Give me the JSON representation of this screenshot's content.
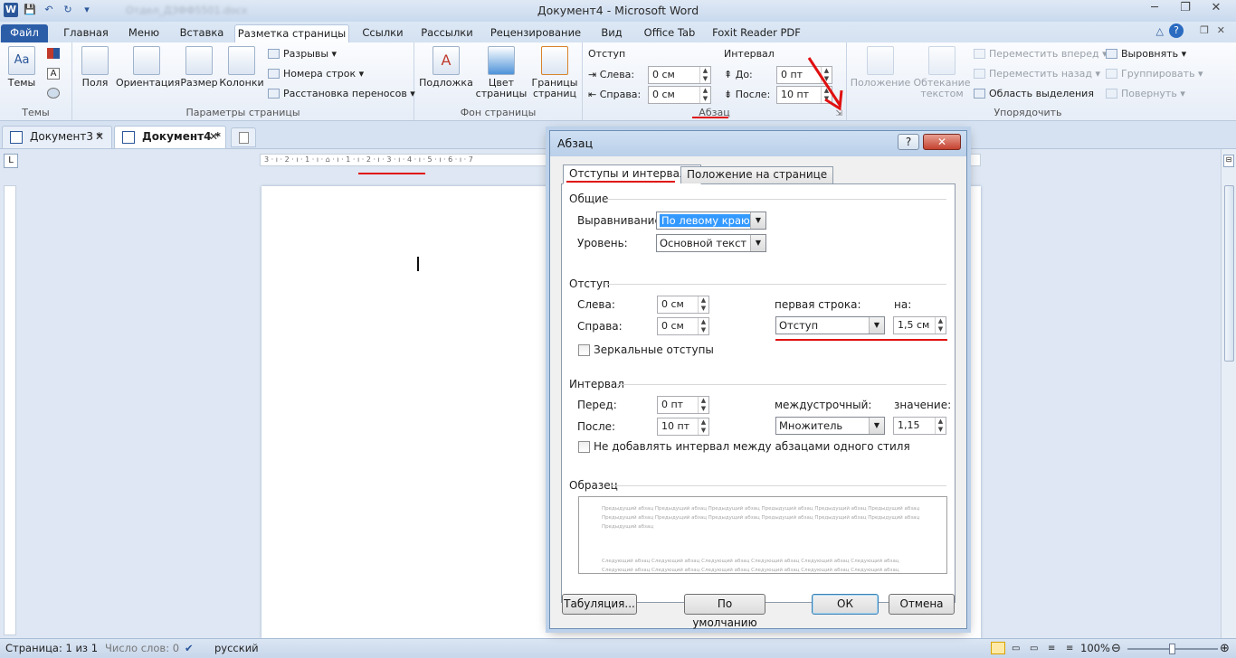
{
  "window": {
    "title": "Документ4 - Microsoft Word",
    "blurred_path": "Отдел_ДЗФФ5501.docx"
  },
  "ribbon_tabs": [
    "Файл",
    "Главная",
    "Меню",
    "Вставка",
    "Разметка страницы",
    "Ссылки",
    "Рассылки",
    "Рецензирование",
    "Вид",
    "Office Tab",
    "Foxit Reader PDF"
  ],
  "groups": {
    "themes": {
      "label": "Темы",
      "btn": "Темы"
    },
    "page_setup": {
      "label": "Параметры страницы",
      "margins": "Поля",
      "orientation": "Ориентация",
      "size": "Размер",
      "columns": "Колонки",
      "breaks": "Разрывы",
      "line_numbers": "Номера строк",
      "hyphenation": "Расстановка переносов"
    },
    "page_bg": {
      "label": "Фон страницы",
      "watermark": "Подложка",
      "page_color_1": "Цвет",
      "page_color_2": "страницы",
      "borders_1": "Границы",
      "borders_2": "страниц"
    },
    "paragraph": {
      "label": "Абзац",
      "indent": "Отступ",
      "left": "Слева:",
      "left_val": "0 см",
      "right": "Справа:",
      "right_val": "0 см",
      "spacing": "Интервал",
      "before": "До:",
      "before_val": "0 пт",
      "after": "После:",
      "after_val": "10 пт"
    },
    "arrange": {
      "label": "Упорядочить",
      "position": "Положение",
      "wrap_1": "Обтекание",
      "wrap_2": "текстом",
      "forward": "Переместить вперед",
      "backward": "Переместить назад",
      "selection_pane": "Область выделения",
      "align": "Выровнять",
      "group": "Группировать",
      "rotate": "Повернуть"
    }
  },
  "doc_tabs": [
    {
      "label": "Документ3 *"
    },
    {
      "label": "Документ4 *"
    }
  ],
  "ruler_text": "3 · ı · 2 · ı · 1 · ı · ⌂ · ı · 1 · ı · 2 · ı · 3 · ı · 4 · ı · 5 · ı · 6 · ı · 7",
  "status": {
    "page": "Страница: 1 из 1",
    "words": "Число слов: 0",
    "lang": "русский",
    "zoom": "100%"
  },
  "dialog": {
    "title": "Абзац",
    "help": "?",
    "close": "✕",
    "tab_active": "Отступы и интервалы",
    "tab_inactive": "Положение на странице",
    "general": {
      "title": "Общие",
      "alignment_label": "Выравнивание:",
      "alignment_value": "По левому краю",
      "level_label": "Уровень:",
      "level_value": "Основной текст"
    },
    "indent": {
      "title": "Отступ",
      "left_label": "Слева:",
      "left_value": "0 см",
      "right_label": "Справа:",
      "right_value": "0 см",
      "first_line_label": "первая строка:",
      "first_line_value": "Отступ",
      "by_label": "на:",
      "by_value": "1,5 см",
      "mirror_label": "Зеркальные отступы"
    },
    "spacing": {
      "title": "Интервал",
      "before_label": "Перед:",
      "before_value": "0 пт",
      "after_label": "После:",
      "after_value": "10 пт",
      "line_label": "междустрочный:",
      "line_value": "Множитель",
      "at_label": "значение:",
      "at_value": "1,15",
      "nospace_label": "Не добавлять интервал между абзацами одного стиля"
    },
    "preview": {
      "title": "Образец",
      "prev_text": "Предыдущий абзац Предыдущий абзац Предыдущий абзац Предыдущий абзац Предыдущий абзац Предыдущий абзац Предыдущий абзац Предыдущий абзац Предыдущий абзац Предыдущий абзац Предыдущий абзац Предыдущий абзац Предыдущий абзац",
      "next_text": "Следующий абзац Следующий абзац Следующий абзац Следующий абзац Следующий абзац Следующий абзац Следующий абзац Следующий абзац Следующий абзац Следующий абзац Следующий абзац Следующий абзац Следующий абзац Следующий абзац"
    },
    "buttons": {
      "tabs": "Табуляция...",
      "default": "По умолчанию",
      "ok": "ОК",
      "cancel": "Отмена"
    }
  }
}
